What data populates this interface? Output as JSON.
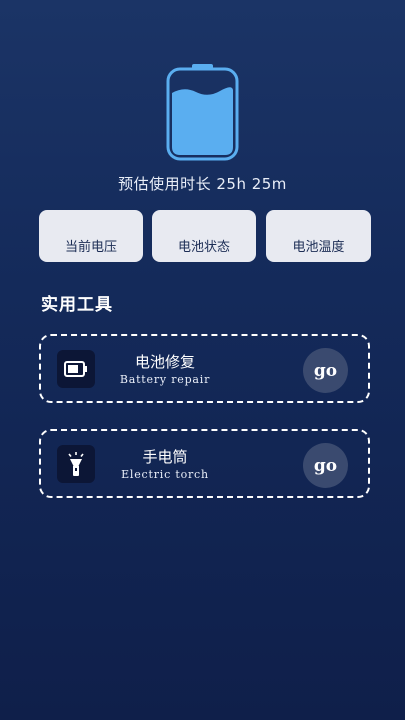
{
  "battery": {
    "icon": "battery-water-icon",
    "estimate_label": "预估使用时长",
    "estimate_value": "25h 25m",
    "fill_level": 0.72,
    "accent_color": "#5aaef0"
  },
  "cards": [
    {
      "label": "当前电压"
    },
    {
      "label": "电池状态"
    },
    {
      "label": "电池温度"
    }
  ],
  "tools_section": {
    "title": "实用工具",
    "items": [
      {
        "name": "电池修复",
        "subtitle": "Battery repair",
        "icon": "battery-icon",
        "action": "go"
      },
      {
        "name": "手电筒",
        "subtitle": "Electric torch",
        "icon": "flashlight-icon",
        "action": "go"
      }
    ]
  }
}
